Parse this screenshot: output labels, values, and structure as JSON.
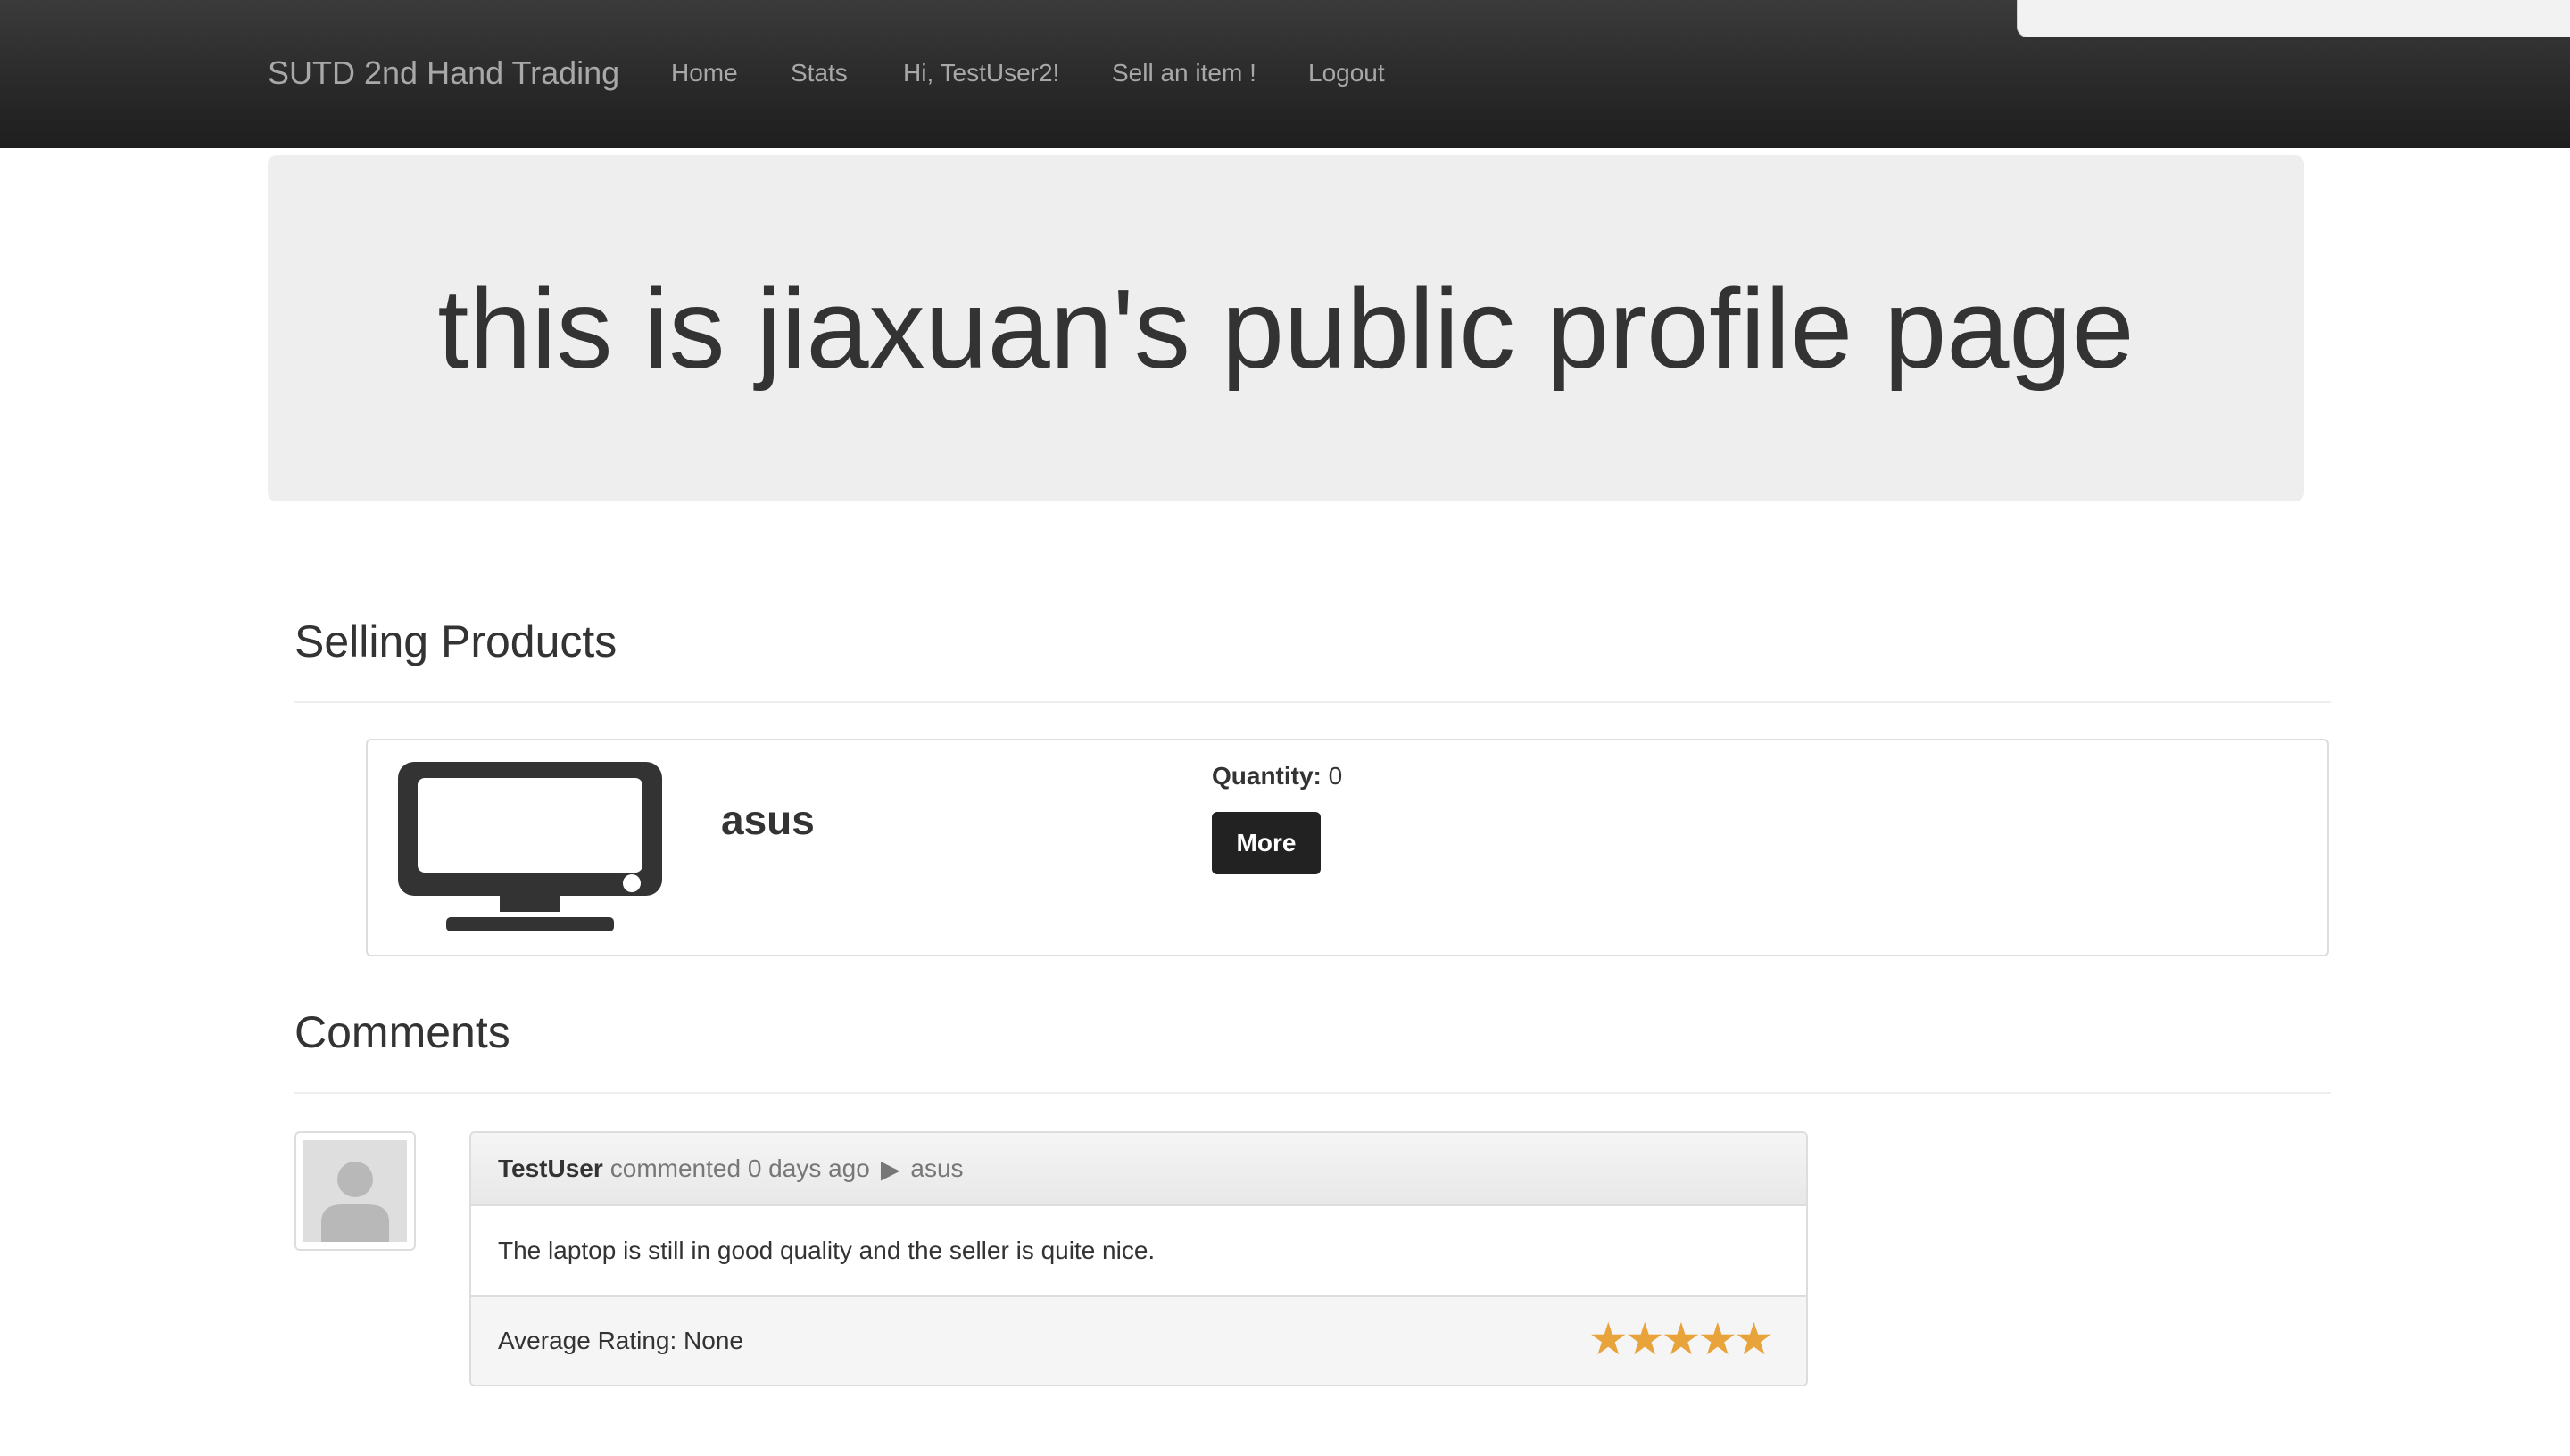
{
  "navbar": {
    "brand": "SUTD 2nd Hand Trading",
    "links": [
      "Home",
      "Stats",
      "Hi, TestUser2!",
      "Sell an item !",
      "Logout"
    ]
  },
  "jumbotron": {
    "title": "this is jiaxuan's public profile page"
  },
  "selling": {
    "heading": "Selling Products",
    "products": [
      {
        "icon": "monitor-icon",
        "name": "asus",
        "quantity_label": "Quantity:",
        "quantity_value": "0",
        "button_label": "More"
      }
    ]
  },
  "comments": {
    "heading": "Comments",
    "items": [
      {
        "avatar_icon": "user-avatar-icon",
        "author": "TestUser",
        "action": "commented 0 days ago",
        "arrow": "▶",
        "product": "asus",
        "body": "The laptop is still in good quality and the seller is quite nice.",
        "rating_text": "Average Rating: None",
        "stars": "★★★★★",
        "star_count": 5
      }
    ]
  },
  "colors": {
    "navbar": "#2a2a2a",
    "jumbotron": "#eeeeee",
    "button": "#222222",
    "star": "#e8a33b"
  }
}
